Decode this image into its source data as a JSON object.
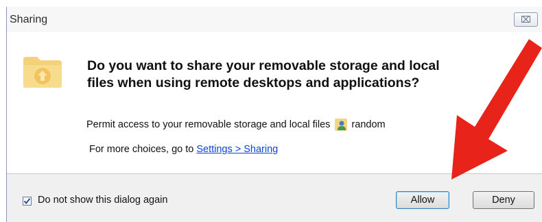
{
  "dialog": {
    "title": "Sharing",
    "close_glyph": "⌧",
    "heading_line1": "Do you want to share your removable storage and local",
    "heading_line2": "files when using remote desktops and applications?",
    "permit_text": "Permit access to your removable storage and local files",
    "user_name": "random",
    "more_prefix": "For more choices, go to ",
    "settings_link": "Settings > Sharing",
    "checkbox_label": "Do not show this dialog again",
    "checkbox_checked": true,
    "allow_label": "Allow",
    "deny_label": "Deny"
  },
  "icons": {
    "folder": "folder-upload-icon",
    "user": "user-icon",
    "checkmark": "checkmark-icon",
    "arrow": "red-arrow-annotation"
  },
  "colors": {
    "link": "#0645d8",
    "arrow": "#e8231a",
    "folder": "#f2c94c"
  }
}
